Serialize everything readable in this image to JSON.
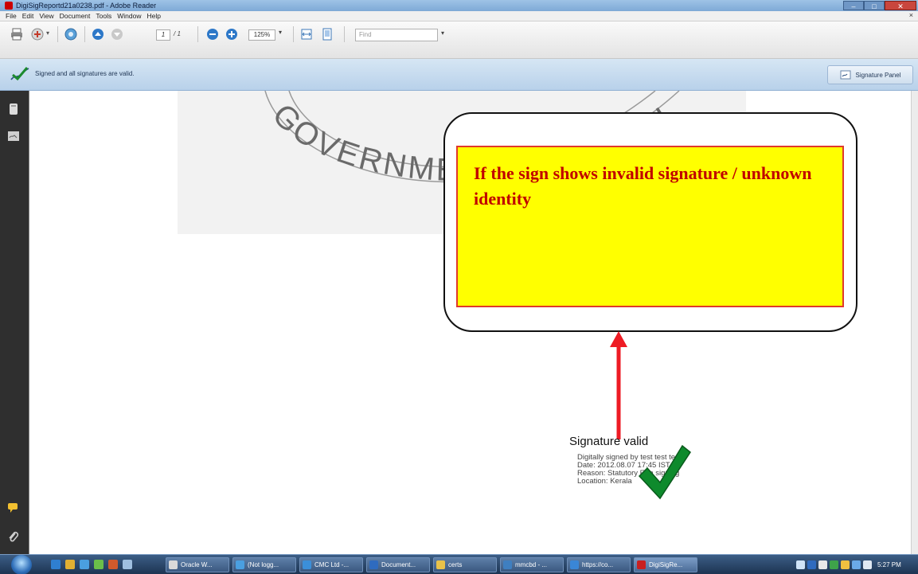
{
  "window": {
    "title": "DigiSigReportd21a0238.pdf - Adobe Reader"
  },
  "menu": [
    "File",
    "Edit",
    "View",
    "Document",
    "Tools",
    "Window",
    "Help"
  ],
  "menu_close_glyph": "×",
  "toolbar": {
    "page_current": "1",
    "page_total": "/ 1",
    "zoom": "125%",
    "zoom_dropdown": "▾",
    "find_placeholder": "Find",
    "find_dropdown": "▾"
  },
  "signature_bar": {
    "status": "Signed and all signatures are valid.",
    "panel_button": "Signature Panel"
  },
  "document": {
    "seal_text": "GOVERNMENT OF KERALA",
    "callout_text": "If the sign shows invalid signature / unknown identity",
    "signature": {
      "title": "Signature valid",
      "line1": "Digitally signed by test test test",
      "line2": "Date: 2012.08.07 17:45 IST",
      "line3": "Reason: Statutory E-in signing",
      "line4": "Location: Kerala"
    },
    "colors": {
      "callout_fill": "#ffff00",
      "callout_text": "#c00000",
      "arrow": "#ee1b24",
      "checkmark": "#0e8a2c"
    }
  },
  "taskbar": {
    "tasks": [
      {
        "label": "Oracle W...",
        "icon_color": "#d9d9d9"
      },
      {
        "label": "(Not logg...",
        "icon_color": "#4a9fe0"
      },
      {
        "label": "CMC Ltd -...",
        "icon_color": "#3b8fd9"
      },
      {
        "label": "Document...",
        "icon_color": "#2f6bbf"
      },
      {
        "label": "certs",
        "icon_color": "#e8c24a"
      },
      {
        "label": "mmcbd - ...",
        "icon_color": "#3f7fc0"
      },
      {
        "label": "https://co...",
        "icon_color": "#3a86d6"
      },
      {
        "label": "DigiSigRe...",
        "icon_color": "#c92020"
      }
    ],
    "clock": "5:27 PM"
  }
}
